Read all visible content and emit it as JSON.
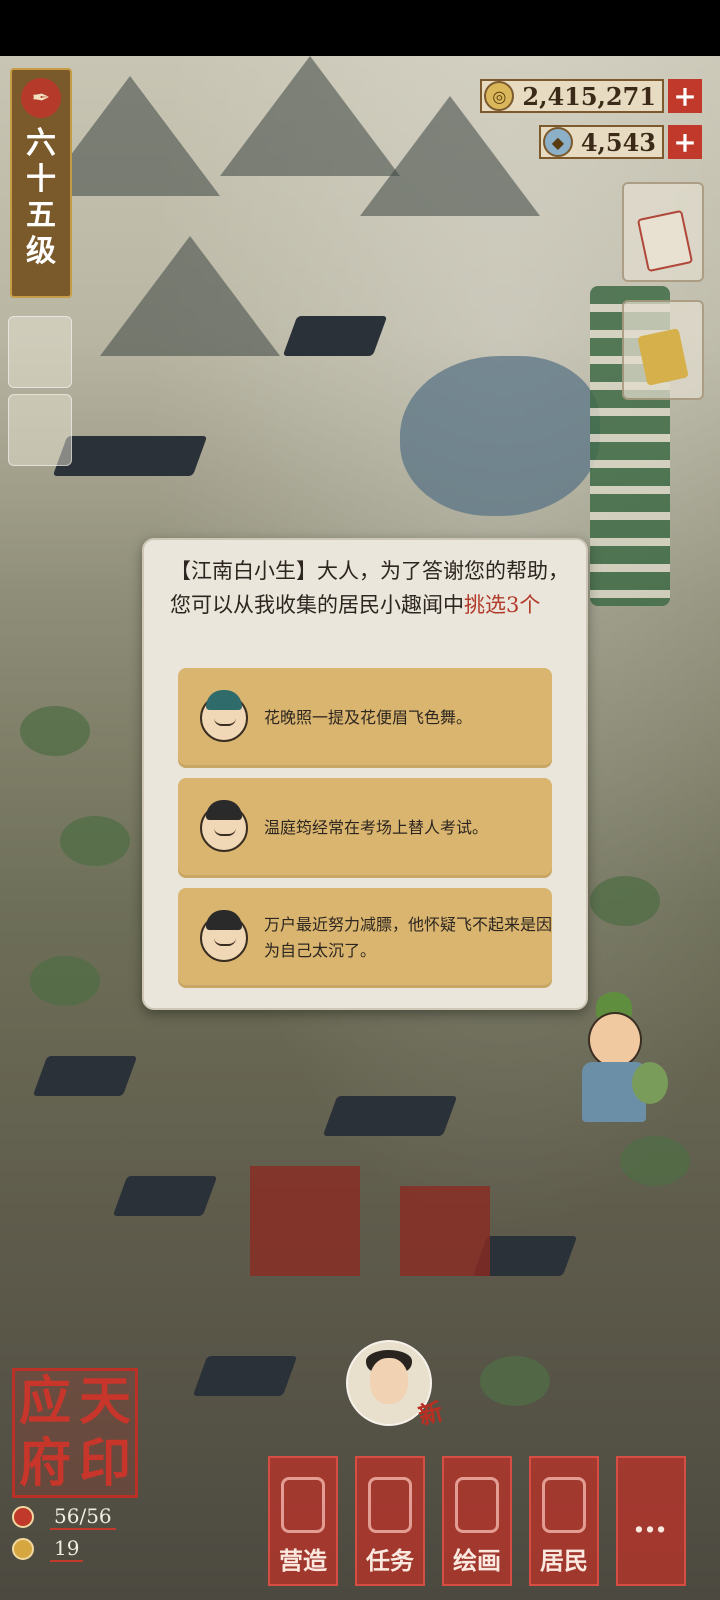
{
  "level": {
    "icon": "brush-icon",
    "label": "六十五级"
  },
  "resources": [
    {
      "name": "coin",
      "icon": "copper-coin-icon",
      "value": "2,415,271",
      "plus": "+"
    },
    {
      "name": "jade",
      "icon": "jade-gem-icon",
      "value": "4,543",
      "plus": "+"
    }
  ],
  "dialog": {
    "speaker": "【江南白小生】",
    "text_plain": "大人，为了答谢您的帮助，您可以从我收集的居民小趣闻中",
    "text_highlight": "挑选3个",
    "options": [
      {
        "avatar": "teal-hair-woman-avatar-icon",
        "text": "花晚照一提及花便眉飞色舞。"
      },
      {
        "avatar": "scholar-man-avatar-icon",
        "text": "温庭筠经常在考场上替人考试。"
      },
      {
        "avatar": "official-man-avatar-icon",
        "text": "万户最近努力减膘，他怀疑飞不起来是因为自己太沉了。"
      }
    ]
  },
  "npc": {
    "new_tag": "新"
  },
  "city": {
    "name_chars": [
      "应",
      "天",
      "府",
      "印"
    ],
    "population": "56/56",
    "gold_count": "19"
  },
  "nav": [
    {
      "label": "营造",
      "icon": "build-icon"
    },
    {
      "label": "任务",
      "icon": "task-scroll-icon"
    },
    {
      "label": "绘画",
      "icon": "painting-scroll-icon"
    },
    {
      "label": "居民",
      "icon": "resident-icon"
    },
    {
      "label": "…",
      "icon": "more-icon"
    }
  ],
  "colors": {
    "highlight": "#b23a2a",
    "option_bg": "#d9b56f",
    "nav_red": "#be3228"
  }
}
